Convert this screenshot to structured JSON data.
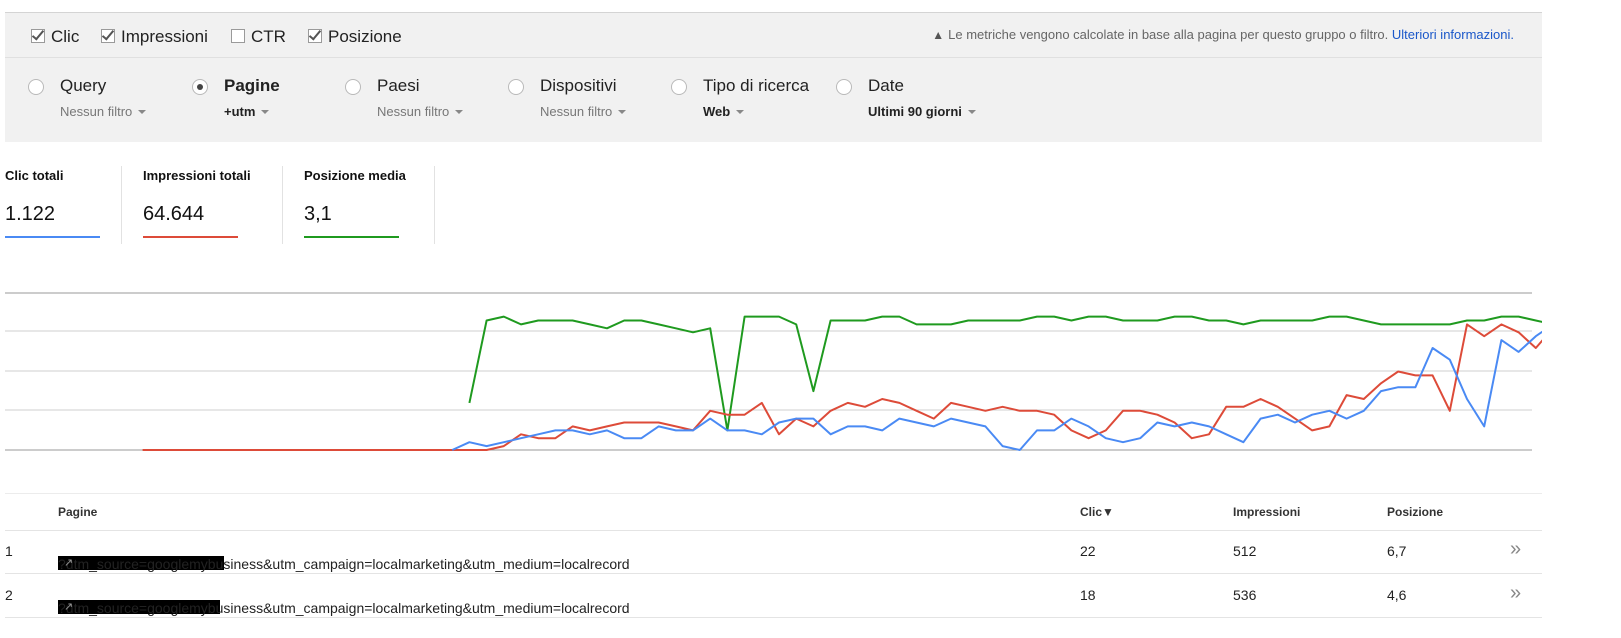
{
  "metrics_toggles": [
    {
      "label": "Clic",
      "checked": true
    },
    {
      "label": "Impressioni",
      "checked": true
    },
    {
      "label": "CTR",
      "checked": false
    },
    {
      "label": "Posizione",
      "checked": true
    }
  ],
  "notice": {
    "text": "Le metriche vengono calcolate in base alla pagina per questo gruppo o filtro.",
    "link": "Ulteriori informazioni."
  },
  "filters": [
    {
      "label": "Query",
      "value": "Nessun filtro",
      "selected": false
    },
    {
      "label": "Pagine",
      "value": "+utm",
      "selected": true
    },
    {
      "label": "Paesi",
      "value": "Nessun filtro",
      "selected": false
    },
    {
      "label": "Dispositivi",
      "value": "Nessun filtro",
      "selected": false
    },
    {
      "label": "Tipo di ricerca",
      "value": "Web",
      "selected": false
    },
    {
      "label": "Date",
      "value": "Ultimi 90 giorni",
      "selected": false
    }
  ],
  "summary": {
    "clicks": {
      "label": "Clic totali",
      "value": "1.122",
      "color": "#4a8af4"
    },
    "impressions": {
      "label": "Impressioni totali",
      "value": "64.644",
      "color": "#dd4b39"
    },
    "position": {
      "label": "Posizione media",
      "value": "3,1",
      "color": "#1f9a1f"
    }
  },
  "chart_data": {
    "type": "line",
    "x_count": 90,
    "grid": true,
    "series": [
      {
        "color": "#1f9a1f",
        "start": 27,
        "values": [
          12,
          33,
          34,
          32,
          33,
          33,
          33,
          32,
          31,
          33,
          33,
          32,
          31,
          30,
          31,
          5,
          34,
          34,
          34,
          32,
          15,
          33,
          33,
          33,
          34,
          34,
          32,
          32,
          32,
          33,
          33,
          33,
          33,
          34,
          34,
          33,
          34,
          34,
          33,
          33,
          33,
          34,
          34,
          33,
          33,
          32,
          33,
          33,
          33,
          33,
          34,
          34,
          33,
          32,
          32,
          32,
          32,
          32,
          33,
          33,
          34,
          34,
          33,
          32,
          31,
          32,
          33,
          33,
          32,
          33,
          32,
          31,
          29,
          33,
          33,
          32,
          32,
          31,
          30,
          34,
          33,
          32,
          32,
          33,
          32,
          34,
          34
        ]
      },
      {
        "color": "#dd4b39",
        "start": 8,
        "values": [
          0,
          0,
          0,
          0,
          0,
          0,
          0,
          0,
          0,
          0,
          0,
          0,
          0,
          0,
          0,
          0,
          0,
          0,
          0,
          0,
          0,
          1,
          4,
          3,
          3,
          6,
          5,
          6,
          7,
          7,
          7,
          6,
          5,
          10,
          9,
          9,
          12,
          4,
          8,
          6,
          10,
          12,
          11,
          13,
          12,
          10,
          8,
          12,
          11,
          10,
          11,
          10,
          10,
          9,
          5,
          3,
          5,
          10,
          10,
          9,
          7,
          3,
          4,
          11,
          11,
          13,
          11,
          8,
          5,
          6,
          14,
          13,
          17,
          20,
          19,
          19,
          10,
          32,
          29,
          32,
          30,
          26,
          31,
          23,
          16,
          40,
          34,
          32,
          30,
          29,
          28,
          15
        ]
      },
      {
        "color": "#4a8af4",
        "start": 26,
        "values": [
          0,
          2,
          1,
          2,
          3,
          4,
          5,
          5,
          4,
          5,
          3,
          3,
          6,
          5,
          5,
          8,
          5,
          5,
          4,
          7,
          8,
          8,
          4,
          6,
          6,
          5,
          8,
          7,
          6,
          8,
          7,
          6,
          1,
          0,
          5,
          5,
          8,
          6,
          3,
          2,
          3,
          7,
          6,
          7,
          6,
          4,
          2,
          8,
          9,
          7,
          9,
          10,
          8,
          10,
          15,
          16,
          16,
          26,
          23,
          13,
          6,
          28,
          25,
          29,
          32,
          31,
          15,
          12
        ]
      }
    ]
  },
  "table": {
    "headers": {
      "pages": "Pagine",
      "clicks": "Clic▼",
      "impressions": "Impressioni",
      "position": "Posizione"
    },
    "rows": [
      {
        "index": "1",
        "url_suffix": "?utm_source=googlemybusiness&utm_campaign=localmarketing&utm_medium=localrecord",
        "clicks": "22",
        "impressions": "512",
        "position": "6,7"
      },
      {
        "index": "2",
        "url_suffix": "?utm_source=googlemybusiness&utm_campaign=localmarketing&utm_medium=localrecord",
        "clicks": "18",
        "impressions": "536",
        "position": "4,6"
      }
    ]
  }
}
